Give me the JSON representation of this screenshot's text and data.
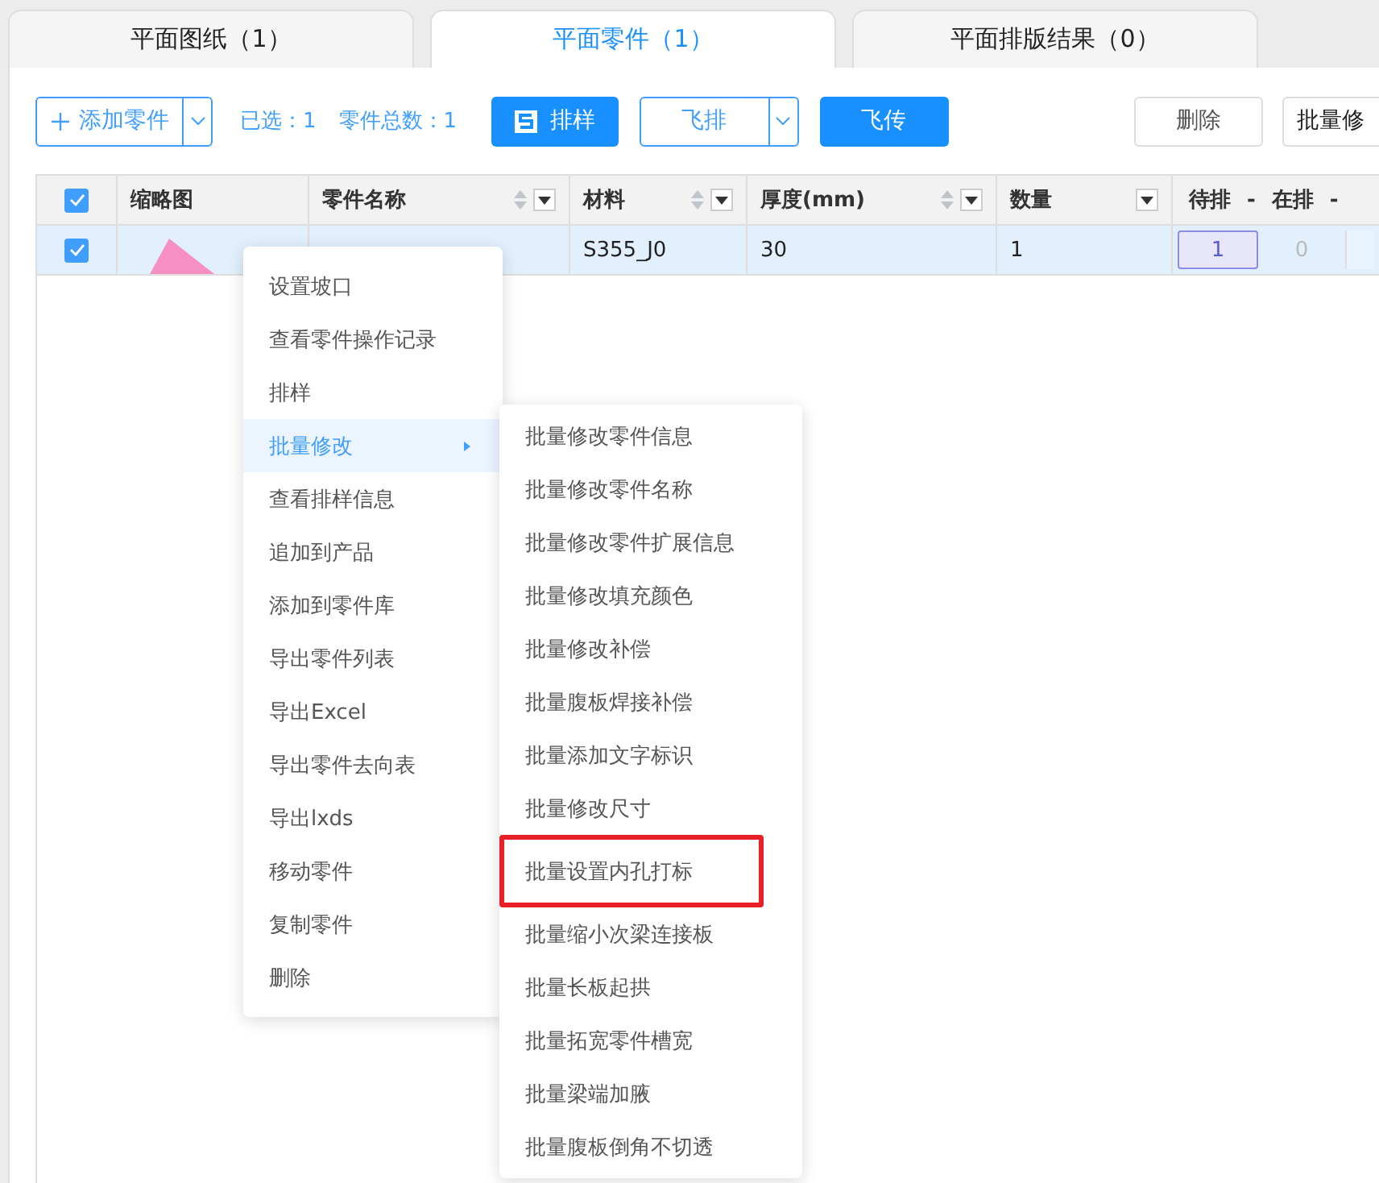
{
  "tabs": [
    {
      "label": "平面图纸（1）",
      "selected": false
    },
    {
      "label": "平面零件（1）",
      "selected": true
    },
    {
      "label": "平面排版结果（0）",
      "selected": false
    }
  ],
  "toolbar": {
    "add_button": "添加零件",
    "selected_count": "已选：1",
    "total_count": "零件总数：1",
    "nest_button": "排样",
    "fly_nest_button": "飞排",
    "fly_send_button": "飞传",
    "delete_button": "删除",
    "batch_button": "批量修"
  },
  "table": {
    "select_all_checked": true,
    "columns": [
      {
        "label": "缩略图",
        "sortable": false,
        "filterable": false
      },
      {
        "label": "零件名称",
        "sortable": true,
        "filterable": true
      },
      {
        "label": "材料",
        "sortable": true,
        "filterable": true
      },
      {
        "label": "厚度(mm)",
        "sortable": true,
        "filterable": true
      },
      {
        "label": "数量",
        "sortable": false,
        "filterable": true
      }
    ],
    "status_labels": [
      "待排",
      "-",
      "在排",
      "-"
    ],
    "rows": [
      {
        "checked": true,
        "material": "S355_J0",
        "thickness": "30",
        "quantity": "1",
        "pending": "1",
        "in_progress": "0"
      }
    ]
  },
  "context_menu": {
    "items": [
      {
        "label": "设置坡口",
        "selected": false,
        "has_submenu": false
      },
      {
        "label": "查看零件操作记录",
        "selected": false,
        "has_submenu": false
      },
      {
        "label": "排样",
        "selected": false,
        "has_submenu": false
      },
      {
        "label": "批量修改",
        "selected": true,
        "has_submenu": true
      },
      {
        "label": "查看排样信息",
        "selected": false,
        "has_submenu": false
      },
      {
        "label": "追加到产品",
        "selected": false,
        "has_submenu": false
      },
      {
        "label": "添加到零件库",
        "selected": false,
        "has_submenu": false
      },
      {
        "label": "导出零件列表",
        "selected": false,
        "has_submenu": false
      },
      {
        "label": "导出Excel",
        "selected": false,
        "has_submenu": false
      },
      {
        "label": "导出零件去向表",
        "selected": false,
        "has_submenu": false
      },
      {
        "label": "导出lxds",
        "selected": false,
        "has_submenu": false
      },
      {
        "label": "移动零件",
        "selected": false,
        "has_submenu": false
      },
      {
        "label": "复制零件",
        "selected": false,
        "has_submenu": false
      },
      {
        "label": "删除",
        "selected": false,
        "has_submenu": false
      }
    ]
  },
  "submenu": {
    "items": [
      {
        "label": "批量修改零件信息",
        "highlighted": false
      },
      {
        "label": "批量修改零件名称",
        "highlighted": false
      },
      {
        "label": "批量修改零件扩展信息",
        "highlighted": false
      },
      {
        "label": "批量修改填充颜色",
        "highlighted": false
      },
      {
        "label": "批量修改补偿",
        "highlighted": false
      },
      {
        "label": "批量腹板焊接补偿",
        "highlighted": false
      },
      {
        "label": "批量添加文字标识",
        "highlighted": false
      },
      {
        "label": "批量修改尺寸",
        "highlighted": false
      },
      {
        "label": "批量设置内孔打标",
        "highlighted": true
      },
      {
        "label": "批量缩小次梁连接板",
        "highlighted": false
      },
      {
        "label": "批量长板起拱",
        "highlighted": false
      },
      {
        "label": "批量拓宽零件槽宽",
        "highlighted": false
      },
      {
        "label": "批量梁端加腋",
        "highlighted": false
      },
      {
        "label": "批量腹板倒角不切透",
        "highlighted": false
      }
    ]
  }
}
